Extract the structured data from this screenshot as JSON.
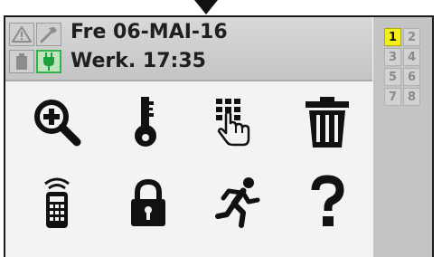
{
  "header": {
    "date": "Fre 06-MAI-16",
    "time": "Werk. 17:35"
  },
  "status_icons": [
    {
      "icon": "warning-icon",
      "active": false
    },
    {
      "icon": "hammer-icon",
      "active": false
    },
    {
      "icon": "battery-icon",
      "active": false
    },
    {
      "icon": "mains-plug-icon",
      "active": true
    }
  ],
  "menu_icons": [
    "zoom-in-icon",
    "key-icon",
    "keypad-touch-icon",
    "trash-icon",
    "remote-control-icon",
    "padlock-icon",
    "running-person-icon",
    "question-mark-icon"
  ],
  "keypad": {
    "keys": [
      "1",
      "2",
      "3",
      "4",
      "5",
      "6",
      "7",
      "8"
    ],
    "active_key": "1"
  },
  "colors": {
    "active_key": "#f4ee1a",
    "status_active": "#2fb34a",
    "header_bg": "#c8c8c8",
    "side_bg": "#c4c4c4"
  }
}
